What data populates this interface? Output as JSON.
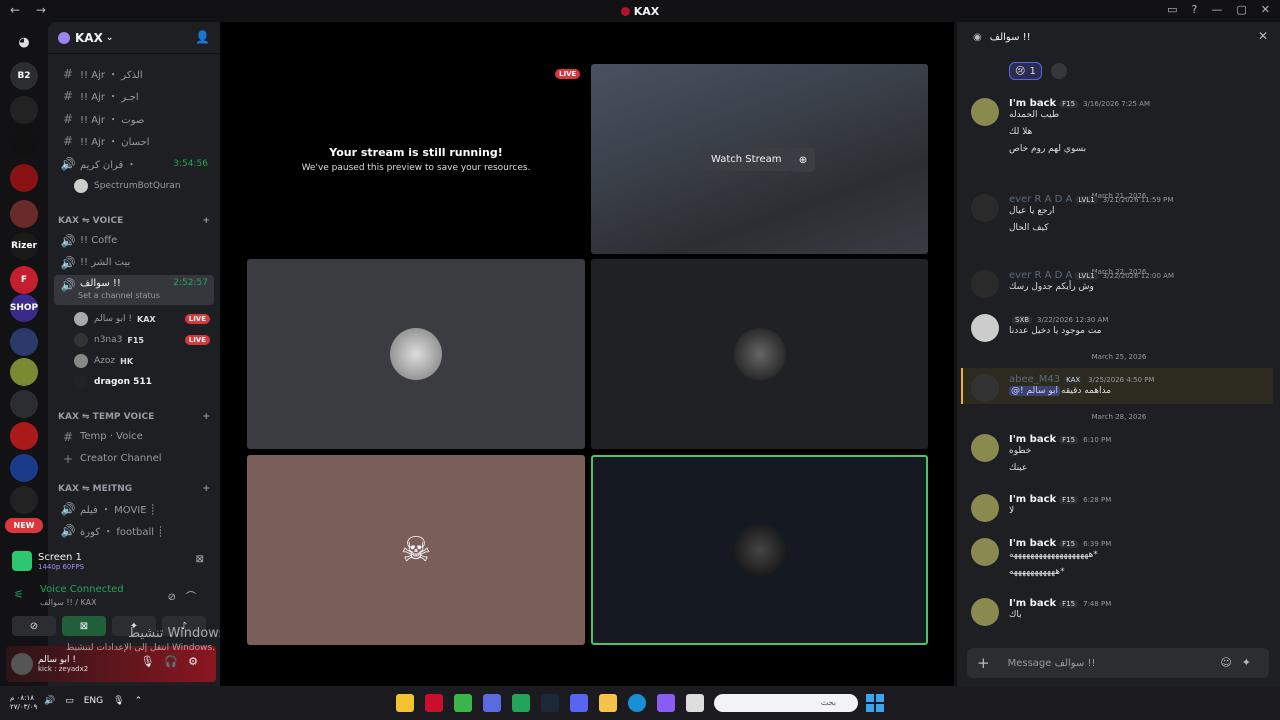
{
  "window": {
    "title": "KAX"
  },
  "rail": {
    "servers": [
      {
        "label": "B2",
        "color": "#2b2d31"
      },
      {
        "label": "",
        "color": "#222"
      },
      {
        "label": "",
        "color": "#111"
      },
      {
        "label": "",
        "color": "#8b1212",
        "badge": "1"
      },
      {
        "label": "",
        "color": "#6a2a2a",
        "badge": "2"
      },
      {
        "label": "Rizer",
        "color": "#1a1a1a"
      },
      {
        "label": "F",
        "color": "#c41f2f"
      },
      {
        "label": "SHOP",
        "color": "#3a2a8a"
      },
      {
        "label": "",
        "color": "#2b3a6a",
        "badge": "9"
      },
      {
        "label": "",
        "color": "#7a8a30"
      },
      {
        "label": "",
        "color": "#2b2d31"
      },
      {
        "label": "",
        "color": "#aa1a1a"
      },
      {
        "label": "",
        "color": "#1a3a8a"
      },
      {
        "label": "",
        "color": "#222",
        "badge": "10"
      }
    ],
    "new_label": "NEW"
  },
  "guild": {
    "name": "KAX"
  },
  "channels": {
    "top": [
      {
        "icon": "#",
        "name": "!! Ajr ・ الذكر",
        "bold": "Ajr"
      },
      {
        "icon": "#",
        "name": "!! Ajr ・ اجـر"
      },
      {
        "icon": "#",
        "name": "!! Ajr ・ صوت"
      },
      {
        "icon": "#",
        "name": "!! Ajr ・ احسان"
      },
      {
        "icon": "🔊",
        "name": "قران كريم ・",
        "timer": "3:54:56"
      }
    ],
    "bot": "SpectrumBotQuran",
    "cat_voice": "KAX ⇋ VOICE",
    "voice": [
      {
        "icon": "🔊",
        "name": "!! Coffe"
      },
      {
        "icon": "🔊",
        "name": "!! بيت الشر"
      }
    ],
    "active": {
      "name": "سوالف !!",
      "timer": "2:52:57",
      "status": "Set a channel status"
    },
    "members": [
      {
        "name": "ابو سالم !",
        "tag": "KAX",
        "live": "LIVE"
      },
      {
        "name": "n3na3",
        "tag": "F15",
        "live": "LIVE"
      },
      {
        "name": "Azoz",
        "tag": "HK"
      },
      {
        "name": "dragon 511"
      }
    ],
    "cat_temp": "KAX ⇋ TEMP VOICE",
    "temp": [
      {
        "icon": "#",
        "name": "Temp · Voice"
      },
      {
        "icon": "+",
        "name": "Creator Channel"
      }
    ],
    "cat_meet": "KAX ⇋ MEITNG",
    "meet": [
      {
        "icon": "🔊",
        "name": "فيلم ・ MOVIE ┊"
      },
      {
        "icon": "🔊",
        "name": "كورة ・ football ┊"
      }
    ]
  },
  "panel": {
    "screen_title": "Screen 1",
    "screen_sub": "1440p 60FPS",
    "voice_connected": "Voice Connected",
    "voice_where": "سوالف !! / KAX",
    "user_name": "ابو سالم !",
    "user_status": "kick : zeyadx2"
  },
  "watermark": {
    "line1": "تنشيط Windows",
    "line2": "انتقل إلى الإعدادات لتنشيط Windows."
  },
  "stage": {
    "live": "LIVE",
    "paused_title": "Your stream is still running!",
    "paused_sub": "We've paused this preview to save your resources.",
    "watch_stream": "Watch Stream"
  },
  "chat": {
    "title": "سوالف !!",
    "reaction_count": "1",
    "messages": [
      {
        "name": "I'm back",
        "tag": "F15",
        "time": "3/16/2026 7:25 AM",
        "lines": [
          "طيب الحمدله",
          "هلا لك",
          "بسوي لهم روم خاص"
        ]
      },
      {
        "divider": "March 21, 2026"
      },
      {
        "name": "ever R A D A",
        "tag": "LVL1",
        "time": "3/21/2026 11:59 PM",
        "lines": [
          "ارجع يا عيال",
          "كيف الحال"
        ]
      },
      {
        "divider": "March 22, 2026"
      },
      {
        "name": "ever R A D A",
        "tag": "LVL1",
        "time": "3/22/2026 12:00 AM",
        "lines": [
          "وش رأيكم جدول رسك"
        ]
      },
      {
        "name": "",
        "tag": "SXB",
        "time": "3/22/2026 12:30 AM",
        "lines": [
          "مت موجود يا دخيل عددنا"
        ]
      },
      {
        "divider": "March 25, 2026"
      },
      {
        "name": "abee_M43",
        "tag": "KAX",
        "time": "3/25/2026 4:50 PM",
        "lines": [
          "مداهمه دقيقه"
        ],
        "mention": "@! ابو سالم"
      },
      {
        "divider": "March 28, 2026"
      },
      {
        "name": "I'm back",
        "tag": "F15",
        "time": "6:10 PM",
        "lines": [
          "خطوه",
          "عينك"
        ]
      },
      {
        "name": "I'm back",
        "tag": "F15",
        "time": "6:28 PM",
        "lines": [
          "لا"
        ]
      },
      {
        "name": "I'm back",
        "tag": "F15",
        "time": "6:39 PM",
        "lines": [
          "هههههههههههههههههههه*",
          "هههههههههههه*"
        ]
      },
      {
        "name": "I'm back",
        "tag": "F15",
        "time": "7:48 PM",
        "lines": [
          "باك"
        ]
      }
    ],
    "placeholder": "Message سوالف !!"
  },
  "taskbar": {
    "time": "٠٨:١٨ م",
    "date": "٢٧/٠٣/٠٩",
    "lang": "ENG",
    "search": "بحث"
  }
}
